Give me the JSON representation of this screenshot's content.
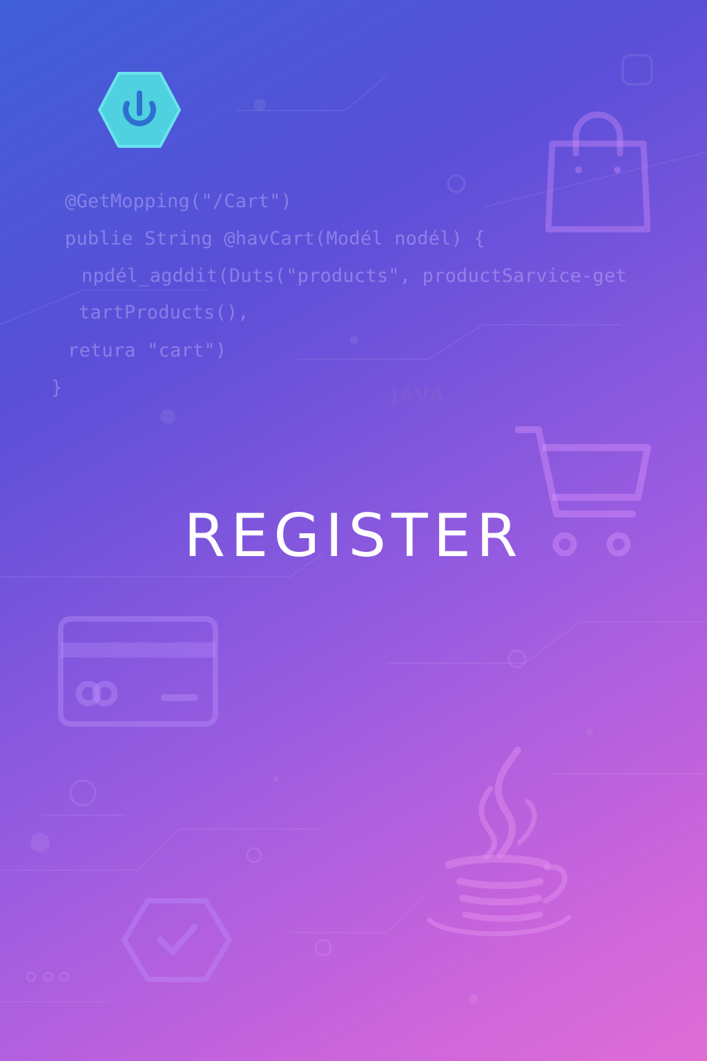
{
  "code_lines": [
    "@GetMopping(\"/Cart\")",
    "publie String @havCart(Modél nodél) {",
    "npdél_agddit(Duts(\"products\", productSarvice-get",
    "tartProducts(),",
    "retura \"cart\")",
    "}"
  ],
  "java_label": "JAVA",
  "title": "REGISTER",
  "colors": {
    "gradient_start": "#3f5fd6",
    "gradient_end": "#e06dd6",
    "logo_fill": "#4fd1e0",
    "logo_symbol": "#2f6fd0",
    "title_text": "#ffffff"
  },
  "icons": [
    "power-logo-icon",
    "shopping-bag-icon",
    "shopping-cart-icon",
    "credit-card-icon",
    "java-cup-icon",
    "check-badge-icon"
  ]
}
